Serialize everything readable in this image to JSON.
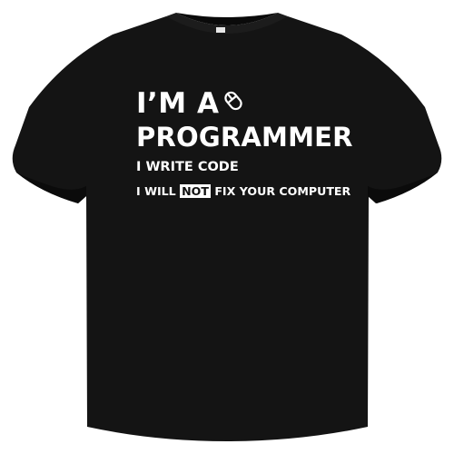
{
  "colors": {
    "background": "#ffffff",
    "shirt": "#141414",
    "shirt_shadow": "#0b0b0b",
    "print": "#ffffff"
  },
  "print": {
    "line1": "I’M A",
    "line1_icon": "computer-mouse-icon",
    "line2": "PROGRAMMER",
    "line3": "I WRITE CODE",
    "line4_before": "I WILL",
    "line4_highlight": "NOT",
    "line4_after": "FIX YOUR COMPUTER"
  }
}
